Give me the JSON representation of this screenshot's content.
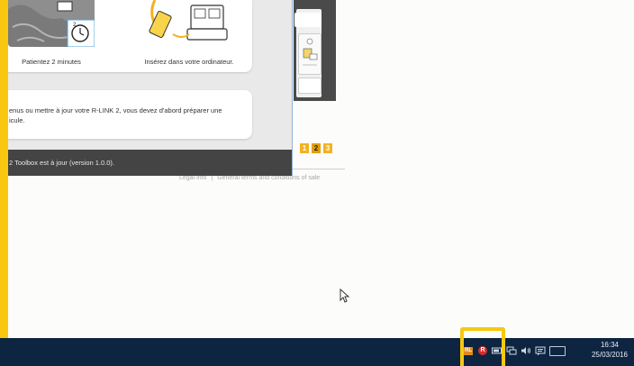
{
  "toolbox": {
    "step1_caption": "Patientez 2 minutes",
    "step2_caption": "Insérez dans votre ordinateur.",
    "info_text": "enus ou mettre à jour votre R-LINK 2, vous devez d'abord préparer une\nicule.",
    "status_text": "2 Toolbox est à jour (version 1.0.0)."
  },
  "background_page": {
    "pages": [
      "1",
      "2",
      "3"
    ],
    "active_page": "2",
    "footer_legal": "Legal info",
    "footer_separator": "|",
    "footer_terms": "General terms and conditions of sale"
  },
  "taskbar": {
    "tray_rlink_label": "RL",
    "tray_r_label": "R",
    "time": "16:34",
    "date": "25/03/2016",
    "icons": [
      "rlink-icon",
      "r-app-icon",
      "battery-icon",
      "network-icon",
      "volume-icon",
      "notification-icon",
      "keyboard-icon"
    ]
  },
  "colors": {
    "accent_yellow": "#f7c80f",
    "taskbar": "#0e2541",
    "status_bar": "#444444",
    "page_orange": "#f3b221"
  }
}
